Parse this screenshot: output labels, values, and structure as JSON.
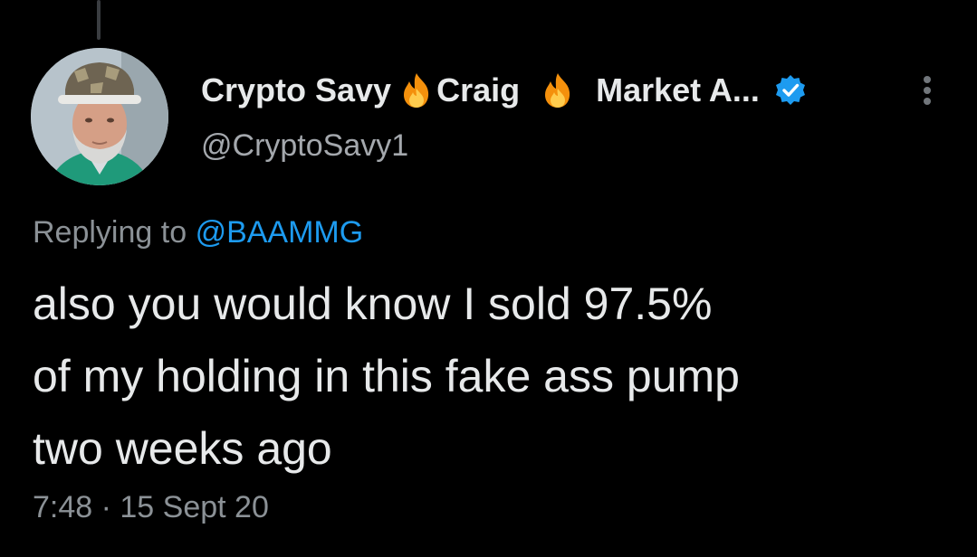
{
  "tweet": {
    "author": {
      "name_part_1": "Crypto Savy",
      "name_part_2": "Craig",
      "name_part_3": "Market A...",
      "emoji_icon": "fire-icon",
      "verified_icon": "verified-badge-icon",
      "handle": "@CryptoSavy1"
    },
    "more_icon": "more-options-icon",
    "replying_to": {
      "prefix": "Replying to",
      "mention": "@BAAMMG"
    },
    "text_lines": [
      "also you would know I sold 97.5%",
      "of my holding in this fake ass pump",
      "two weeks ago"
    ],
    "timestamp": "7:48 · 15 Sept 20"
  },
  "colors": {
    "background": "#000000",
    "text_primary": "#e7e9ea",
    "text_secondary": "#8b9196",
    "link": "#1d9bf0",
    "verified": "#1d9bf0"
  }
}
